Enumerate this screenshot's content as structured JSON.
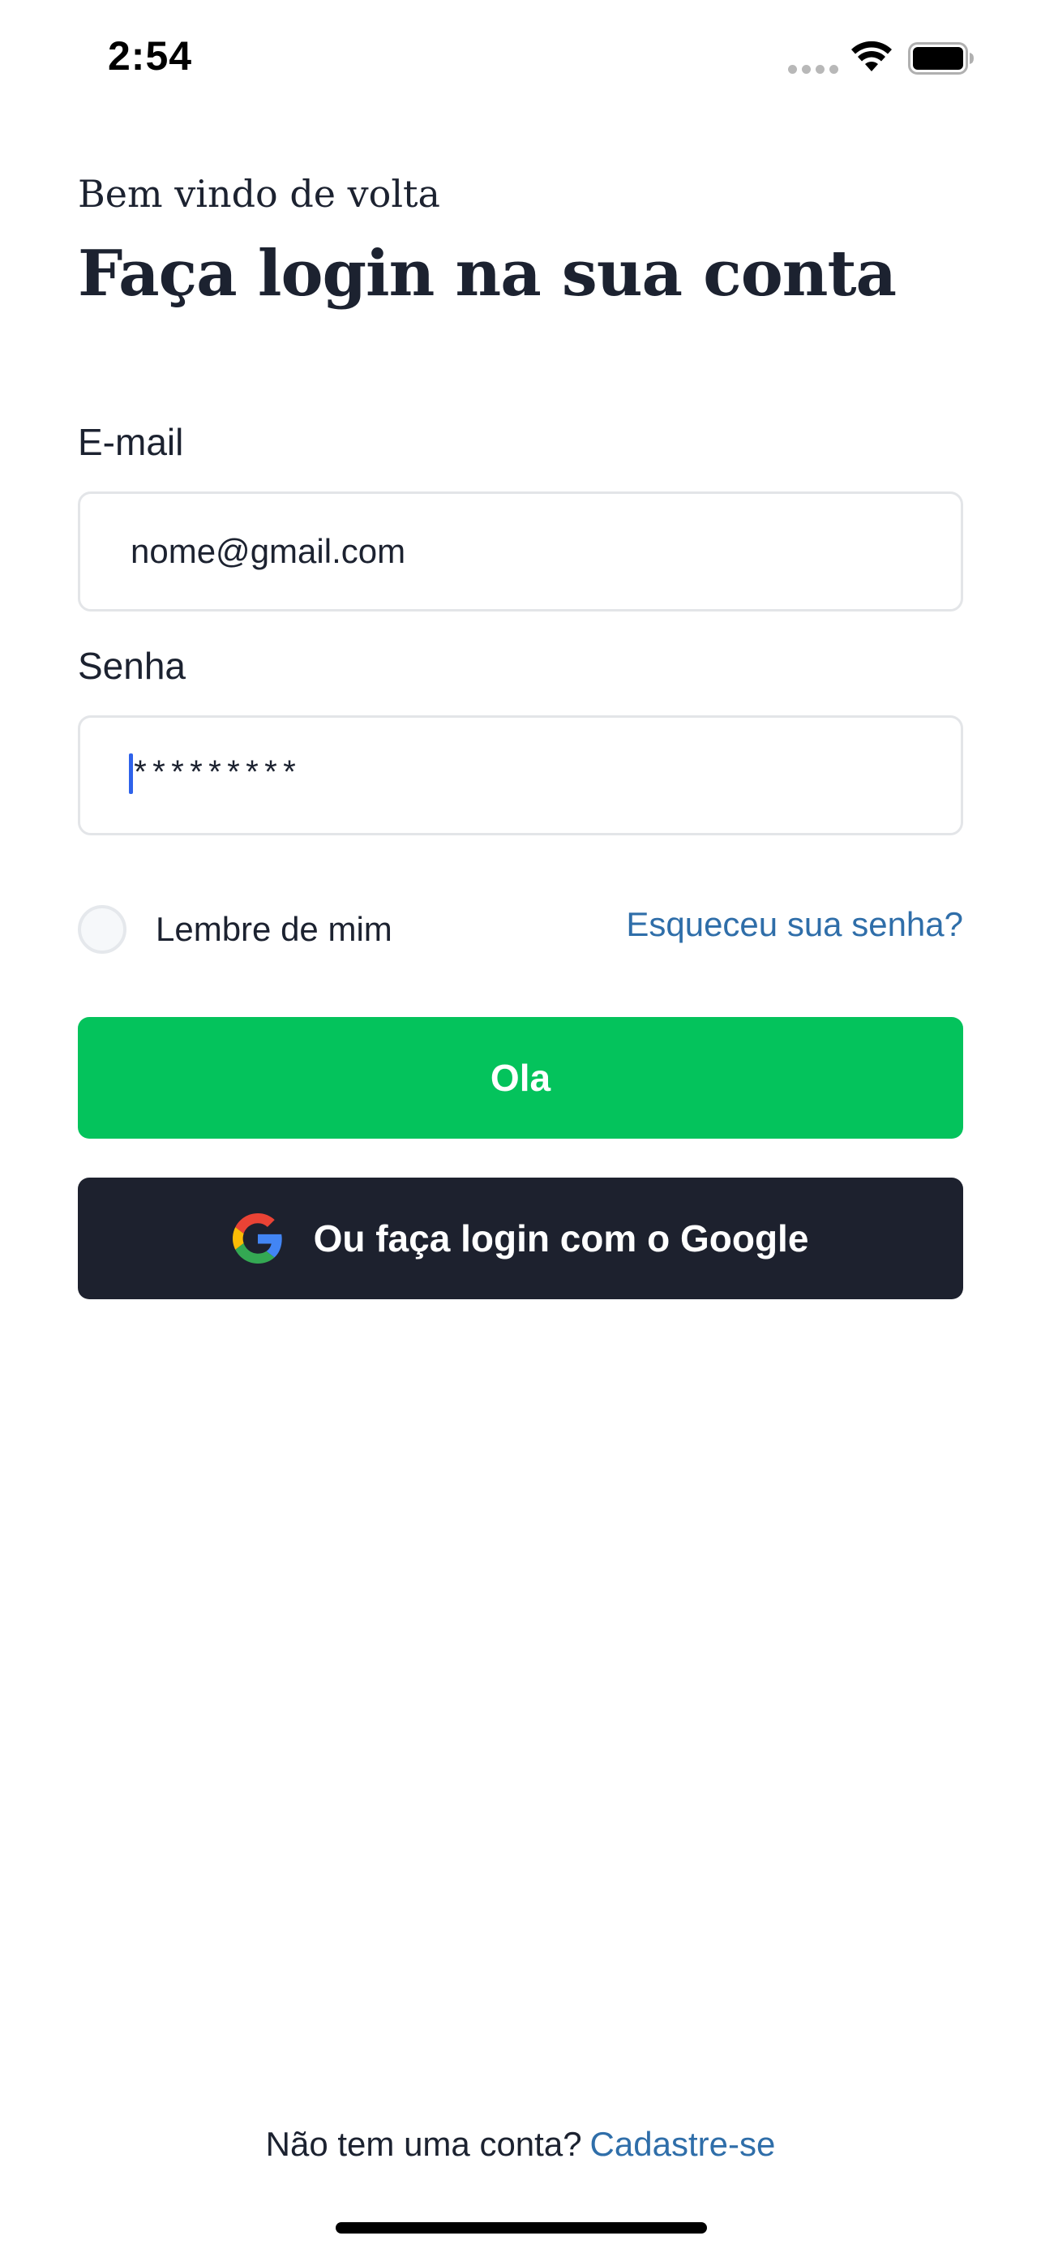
{
  "status_bar": {
    "time": "2:54"
  },
  "header": {
    "greeting": "Bem vindo de volta",
    "title": "Faça login na sua conta"
  },
  "form": {
    "email": {
      "label": "E-mail",
      "value": "nome@gmail.com"
    },
    "password": {
      "label": "Senha",
      "value": "*********"
    },
    "remember_label": "Lembre de mim",
    "remember_checked": false,
    "forgot_link": "Esqueceu sua senha?"
  },
  "buttons": {
    "primary_label": "Ola",
    "google_label": "Ou faça login com o Google"
  },
  "footer": {
    "text": "Não tem uma conta?",
    "signup_link": "Cadastre-se"
  },
  "colors": {
    "primary_green": "#04c35c",
    "dark_button": "#1d212e",
    "link_blue": "#2f6ea9",
    "text_dark": "#1c2230",
    "caret_blue": "#2e62ea"
  },
  "icons": {
    "status": [
      "cellular-signal-icon",
      "wifi-icon",
      "battery-icon"
    ],
    "google": "google-logo-icon"
  }
}
